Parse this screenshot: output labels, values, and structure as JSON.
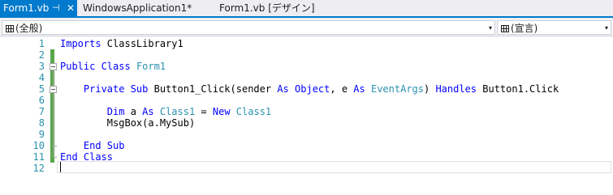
{
  "tabs": {
    "active": {
      "label": "Form1.vb",
      "pin_glyph": "⊣",
      "close_glyph": "✕"
    },
    "second": {
      "label": "WindowsApplication1*"
    },
    "third": {
      "label": "Form1.vb [デザイン]"
    }
  },
  "navbar": {
    "left_combo": "(全般)",
    "right_combo": "(宣言)",
    "arrow": "▾"
  },
  "editor": {
    "line_numbers": [
      "1",
      "2",
      "3",
      "4",
      "5",
      "6",
      "7",
      "8",
      "9",
      "10",
      "11",
      "12"
    ],
    "lines": [
      [
        {
          "t": "Imports ",
          "c": "kw"
        },
        {
          "t": "ClassLibrary1",
          "c": ""
        }
      ],
      [],
      [
        {
          "t": "Public ",
          "c": "kw"
        },
        {
          "t": "Class ",
          "c": "kw"
        },
        {
          "t": "Form1",
          "c": "ty"
        }
      ],
      [],
      [
        {
          "t": "    Private ",
          "c": "kw"
        },
        {
          "t": "Sub ",
          "c": "kw"
        },
        {
          "t": "Button1_Click(sender ",
          "c": ""
        },
        {
          "t": "As ",
          "c": "kw"
        },
        {
          "t": "Object",
          "c": "kw"
        },
        {
          "t": ", e ",
          "c": ""
        },
        {
          "t": "As ",
          "c": "kw"
        },
        {
          "t": "EventArgs",
          "c": "ty"
        },
        {
          "t": ") ",
          "c": ""
        },
        {
          "t": "Handles ",
          "c": "kw"
        },
        {
          "t": "Button1.Click",
          "c": ""
        }
      ],
      [],
      [
        {
          "t": "        Dim ",
          "c": "kw"
        },
        {
          "t": "a ",
          "c": ""
        },
        {
          "t": "As ",
          "c": "kw"
        },
        {
          "t": "Class1",
          "c": "ty"
        },
        {
          "t": " = ",
          "c": ""
        },
        {
          "t": "New ",
          "c": "kw"
        },
        {
          "t": "Class1",
          "c": "ty"
        }
      ],
      [
        {
          "t": "        MsgBox(a.MySub)",
          "c": ""
        }
      ],
      [],
      [
        {
          "t": "    End ",
          "c": "kw"
        },
        {
          "t": "Sub",
          "c": "kw"
        }
      ],
      [
        {
          "t": "End ",
          "c": "kw"
        },
        {
          "t": "Class",
          "c": "kw"
        }
      ],
      []
    ],
    "changed_lines": [
      1,
      2,
      3,
      4,
      5,
      6,
      7,
      8,
      9,
      10
    ]
  }
}
